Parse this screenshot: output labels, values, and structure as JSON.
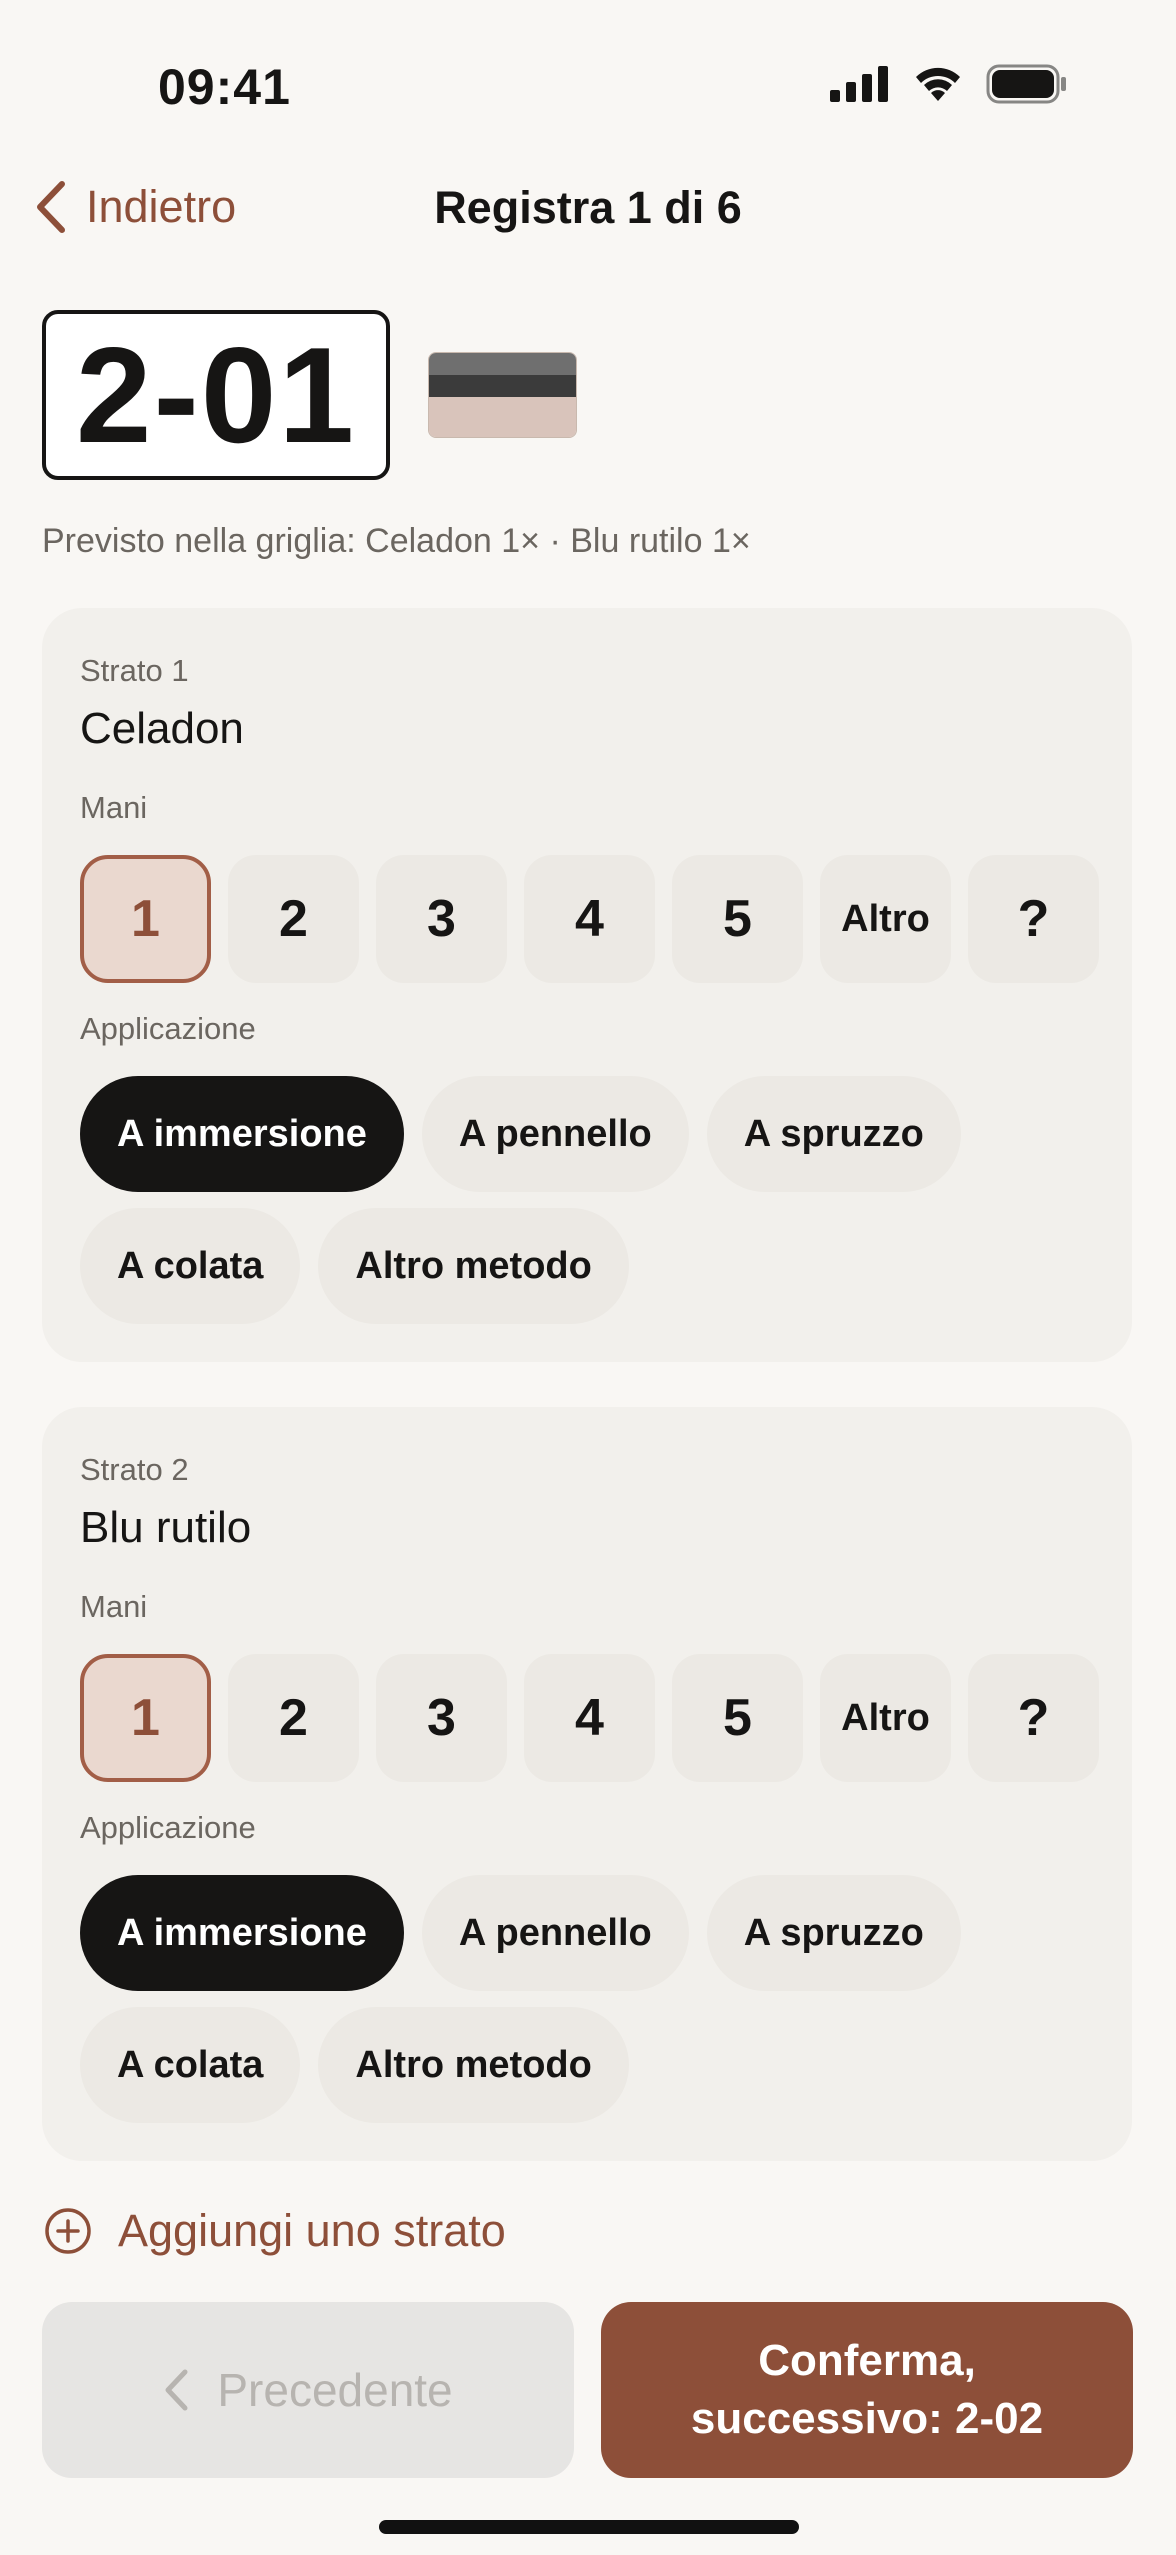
{
  "status": {
    "time": "09:41"
  },
  "nav": {
    "back_label": "Indietro",
    "title": "Registra 1 di 6"
  },
  "item": {
    "code": "2-01",
    "swatch_colors": [
      "#6f6f6f",
      "#3b3b3b",
      "#d9c4bb"
    ],
    "expected_text": "Previsto nella griglia: Celadon 1× · Blu rutilo 1×"
  },
  "labels": {
    "coats": "Mani",
    "application": "Applicazione"
  },
  "layers": [
    {
      "label": "Strato 1",
      "name": "Celadon",
      "coats": [
        "1",
        "2",
        "3",
        "4",
        "5",
        "Altro",
        "?"
      ],
      "selected_coat": "1",
      "methods": [
        "A immersione",
        "A pennello",
        "A spruzzo",
        "A colata",
        "Altro metodo"
      ],
      "selected_method": "A immersione"
    },
    {
      "label": "Strato 2",
      "name": "Blu rutilo",
      "coats": [
        "1",
        "2",
        "3",
        "4",
        "5",
        "Altro",
        "?"
      ],
      "selected_coat": "1",
      "methods": [
        "A immersione",
        "A pennello",
        "A spruzzo",
        "A colata",
        "Altro metodo"
      ],
      "selected_method": "A immersione"
    }
  ],
  "add_layer_label": "Aggiungi uno strato",
  "footer": {
    "prev_label": "Precedente",
    "next_line1": "Conferma,",
    "next_line2": "successivo: 2-02"
  },
  "colors": {
    "accent": "#8d4f39",
    "selected_coat_bg": "#ead8cf",
    "selected_method_bg": "#161514",
    "card_bg": "#f2f0ec",
    "page_bg": "#f9f7f4"
  }
}
